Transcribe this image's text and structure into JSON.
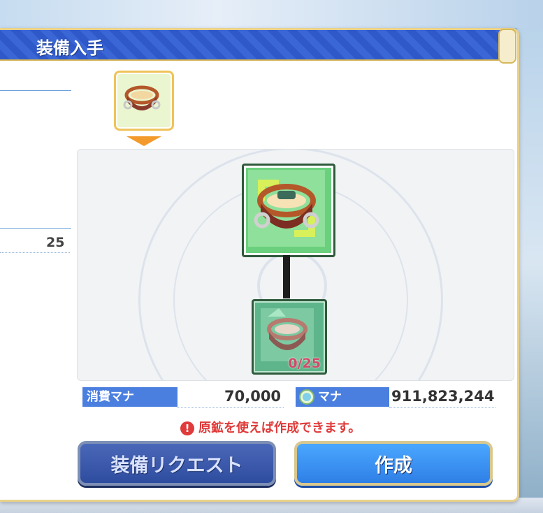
{
  "dialog": {
    "title": "装備入手"
  },
  "left_panel": {
    "value": "25"
  },
  "tree": {
    "material_count": "0/25"
  },
  "stats": {
    "cost_label": "消費マナ",
    "cost_value": "70,000",
    "mana_label": "マナ",
    "mana_value": "911,823,244"
  },
  "warning": {
    "icon": "!",
    "text": "原鉱を使えば作成できます。"
  },
  "buttons": {
    "request": "装備リクエスト",
    "create": "作成"
  },
  "colors": {
    "title_bar": "#3a66d6",
    "accent_gold": "#d6b85a",
    "item_green": "#6bd07e",
    "warning_red": "#e03a3a",
    "button_blue": "#2f7fe6"
  }
}
